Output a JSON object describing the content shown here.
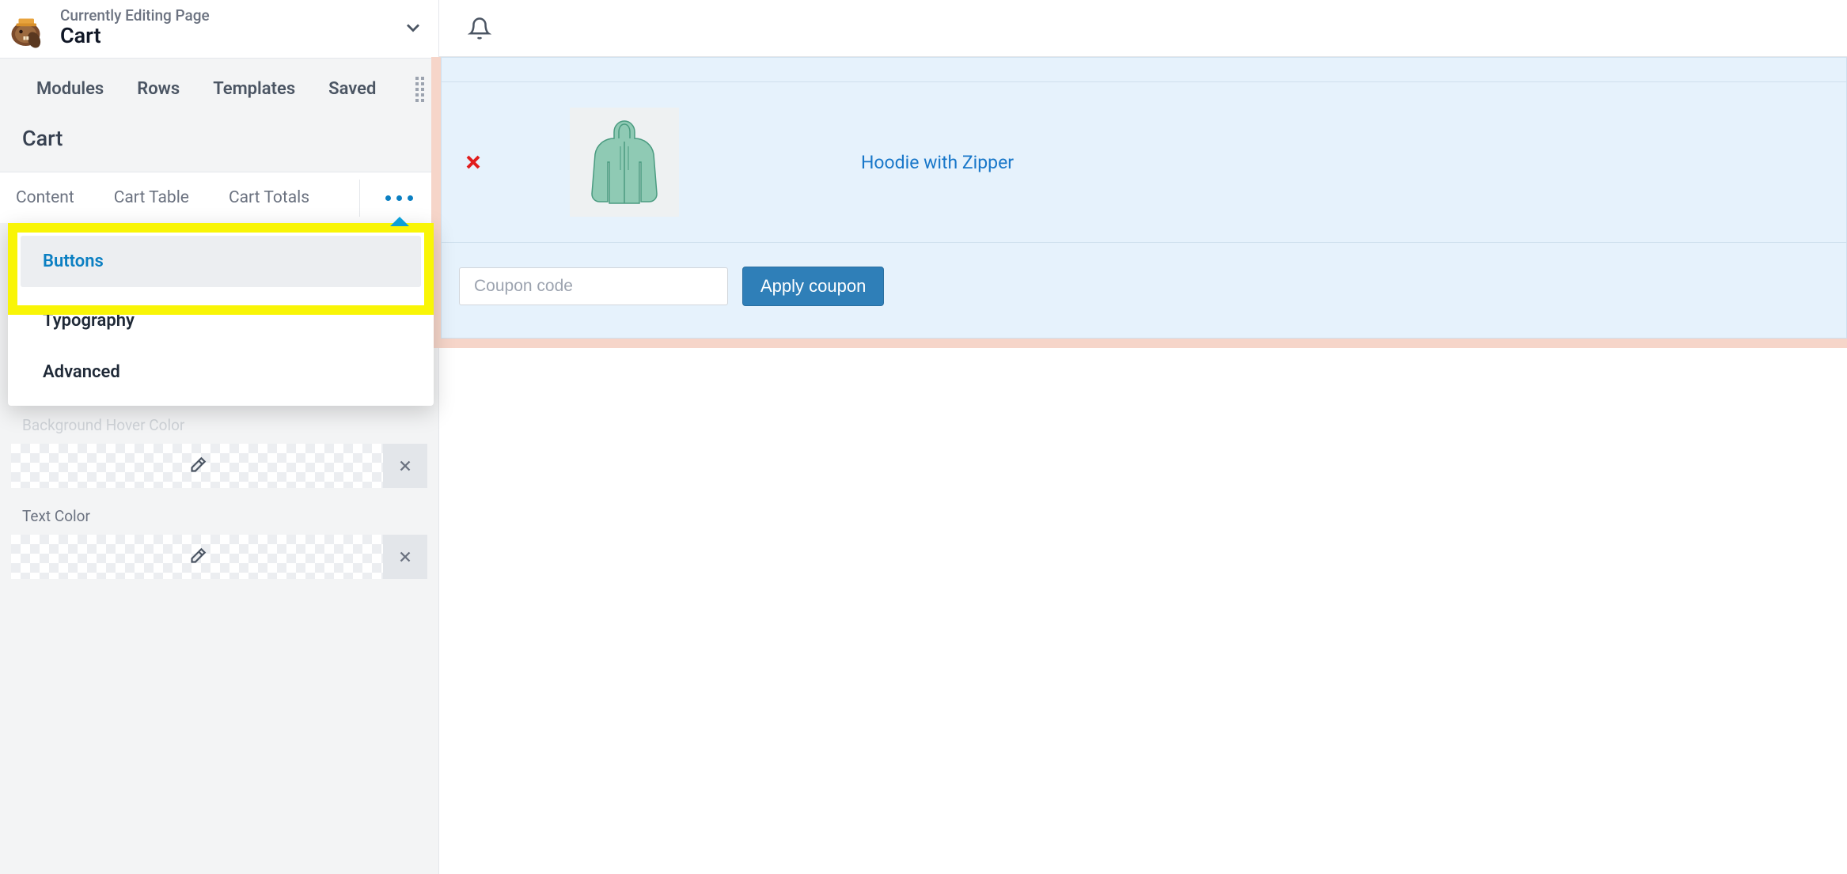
{
  "header": {
    "pretitle": "Currently Editing Page",
    "title": "Cart"
  },
  "main_tabs": [
    "Modules",
    "Rows",
    "Templates",
    "Saved"
  ],
  "section_title": "Cart",
  "sub_tabs": [
    "Content",
    "Cart Table",
    "Cart Totals"
  ],
  "dropdown": {
    "items": [
      "Buttons",
      "Typography",
      "Advanced"
    ],
    "active_index": 0
  },
  "controls": {
    "bg_hover_label": "Background Hover Color",
    "text_color_label": "Text Color"
  },
  "product": {
    "name": "Hoodie with Zipper"
  },
  "coupon": {
    "placeholder": "Coupon code",
    "button": "Apply coupon"
  }
}
